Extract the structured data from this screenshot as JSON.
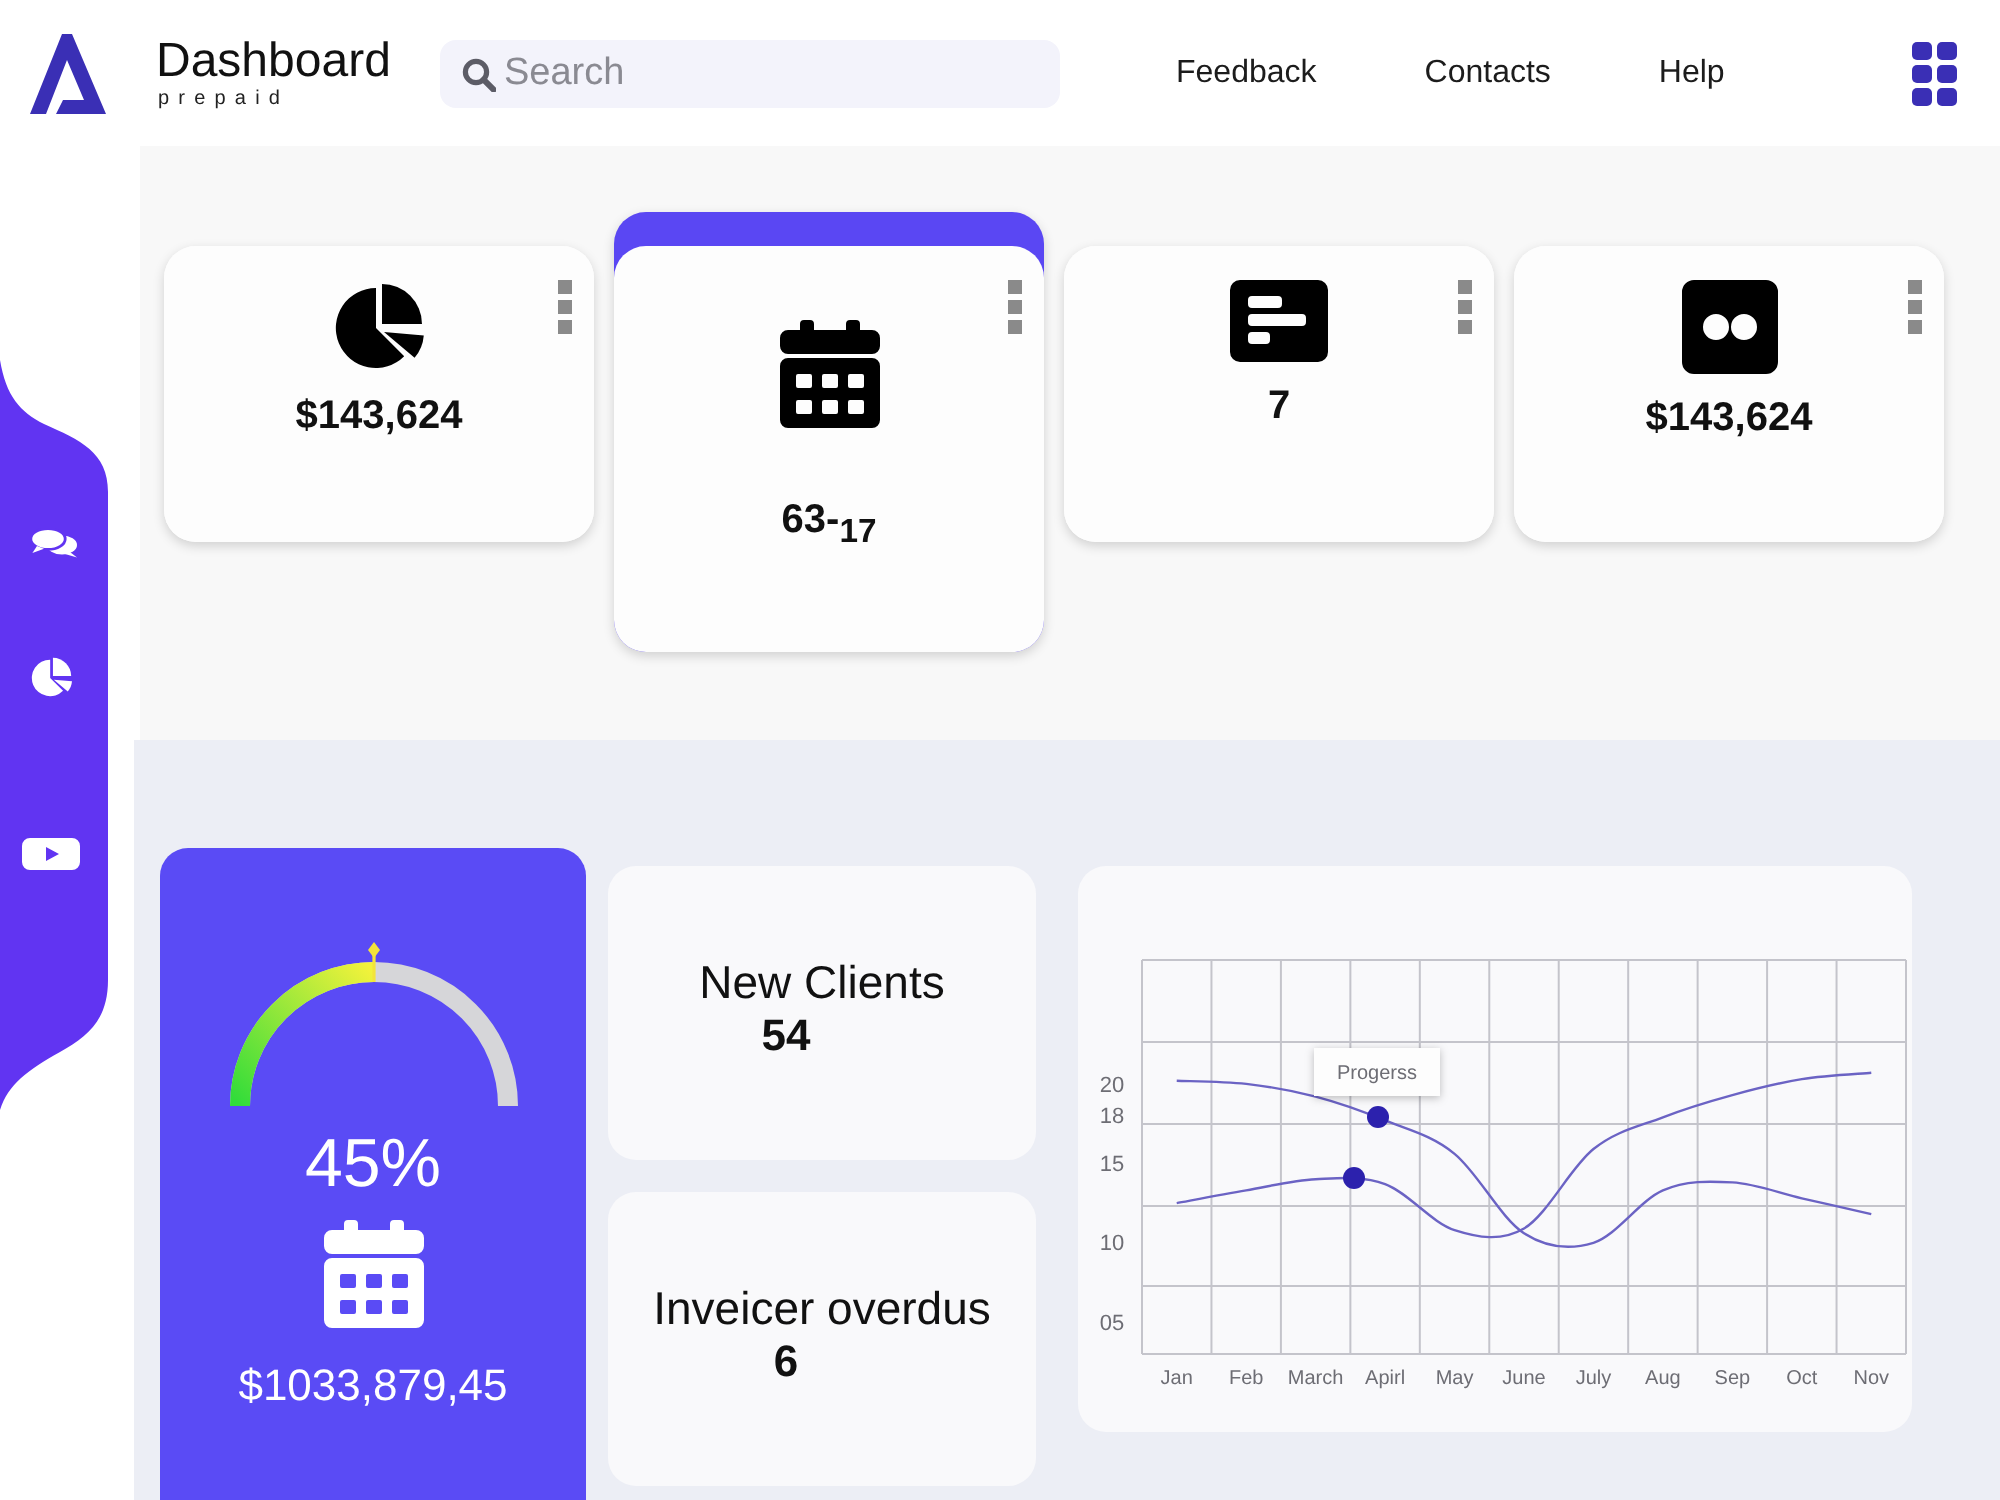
{
  "header": {
    "title": "Dashboard",
    "subtitle": "prepaid",
    "search": {
      "placeholder": "Search"
    },
    "nav": [
      "Feedback",
      "Contacts",
      "Help"
    ]
  },
  "stat_cards": [
    {
      "value": "$143,624",
      "selected": false
    },
    {
      "value": "63-$_{17}$",
      "selected": true
    },
    {
      "value": "7",
      "selected": false
    },
    {
      "value": "$143,624",
      "selected": false
    }
  ],
  "progress_panel": {
    "level": 0.5,
    "reading": "45%",
    "amount": "$1033,879,45"
  },
  "info_cards": [
    {
      "label": "New Clients",
      "value": "54"
    },
    {
      "label": "Inveicer overdus",
      "value": "6"
    }
  ],
  "chart": {
    "chart_data": {
      "type": "line",
      "categories": [
        "Jan",
        "Feb",
        "March",
        "Apirl",
        "May",
        "June",
        "July",
        "Aug",
        "Sep",
        "Oct",
        "Nov"
      ],
      "ylim": [
        3,
        27.8
      ],
      "yticks": [
        {
          "value": 5,
          "label": "05"
        },
        10,
        15,
        18,
        20
      ],
      "series": [
        {
          "color": "#6b63c4",
          "values": [
            20.2,
            20,
            19.2,
            17.7,
            15.6,
            10.6,
            10,
            13.3,
            13.8,
            12.8,
            11.8
          ]
        },
        {
          "color": "#6b63c4",
          "values": [
            12.5,
            13.3,
            14,
            13.7,
            10.8,
            10.9,
            15.9,
            17.9,
            19.3,
            20.3,
            20.7
          ]
        }
      ],
      "annotations": [
        "Progerss"
      ]
    }
  }
}
